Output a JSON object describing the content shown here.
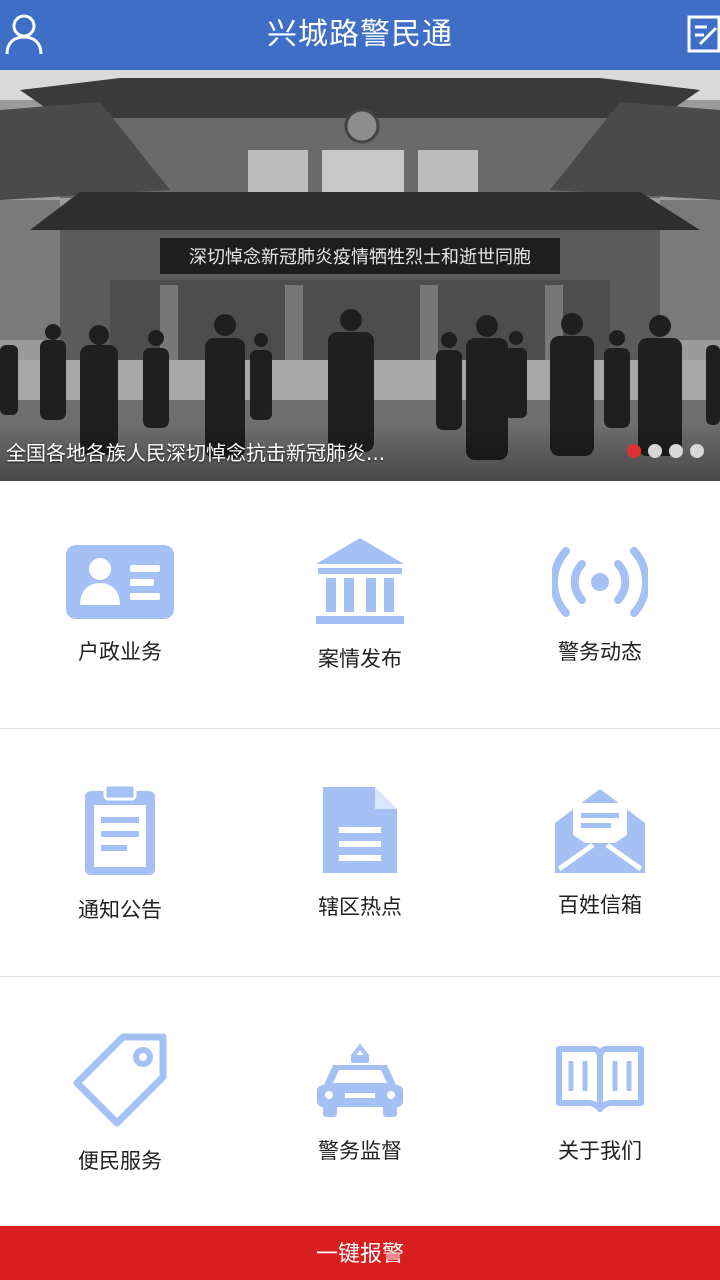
{
  "header": {
    "title": "兴城路警民通",
    "left_icon": "user-icon",
    "right_icon": "edit-note-icon"
  },
  "banner": {
    "image_banner_text": "深切悼念新冠肺炎疫情牺牲烈士和逝世同胞",
    "caption": "全国各地各族人民深切悼念抗击新冠肺炎...",
    "slide_count": 4,
    "active_slide": 1
  },
  "grid": [
    {
      "label": "户政业务",
      "icon": "id-card-icon"
    },
    {
      "label": "案情发布",
      "icon": "institution-icon"
    },
    {
      "label": "警务动态",
      "icon": "broadcast-icon"
    },
    {
      "label": "通知公告",
      "icon": "clipboard-icon"
    },
    {
      "label": "辖区热点",
      "icon": "document-icon"
    },
    {
      "label": "百姓信箱",
      "icon": "open-mail-icon"
    },
    {
      "label": "便民服务",
      "icon": "tag-icon"
    },
    {
      "label": "警务监督",
      "icon": "police-car-icon"
    },
    {
      "label": "关于我们",
      "icon": "open-book-icon"
    }
  ],
  "alarm": {
    "label": "一键报警"
  },
  "colors": {
    "header": "#3e6ec6",
    "icon": "#a4c0f4",
    "alarm": "#d81e1e",
    "active_dot": "#e03030"
  }
}
